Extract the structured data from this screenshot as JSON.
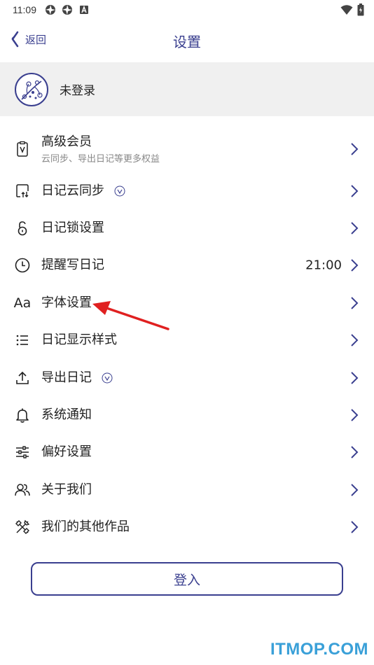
{
  "status_bar": {
    "time": "11:09"
  },
  "nav": {
    "back_label": "返回",
    "title": "设置"
  },
  "user": {
    "name": "未登录"
  },
  "menu": [
    {
      "label": "高级会员",
      "sub": "云同步、导出日记等更多权益",
      "icon": "membership-card-icon"
    },
    {
      "label": "日记云同步",
      "icon": "cloud-sync-icon",
      "badge": "vip-badge-icon"
    },
    {
      "label": "日记锁设置",
      "icon": "lock-icon"
    },
    {
      "label": "提醒写日记",
      "icon": "clock-icon",
      "value": "21:00"
    },
    {
      "label": "字体设置",
      "icon": "font-icon",
      "glyph": "Aa"
    },
    {
      "label": "日记显示样式",
      "icon": "list-icon"
    },
    {
      "label": "导出日记",
      "icon": "upload-icon",
      "badge": "vip-badge-icon"
    },
    {
      "label": "系统通知",
      "icon": "bell-icon"
    },
    {
      "label": "偏好设置",
      "icon": "sliders-icon"
    },
    {
      "label": "关于我们",
      "icon": "people-icon"
    },
    {
      "label": "我们的其他作品",
      "icon": "tools-icon"
    }
  ],
  "login_button": {
    "label": "登入"
  },
  "watermark": {
    "text": "ITMOP.COM"
  },
  "colors": {
    "accent": "#3a3f8f",
    "card_bg": "#f0f0f0",
    "arrow": "#e02020",
    "watermark": "#3aa0d8"
  }
}
